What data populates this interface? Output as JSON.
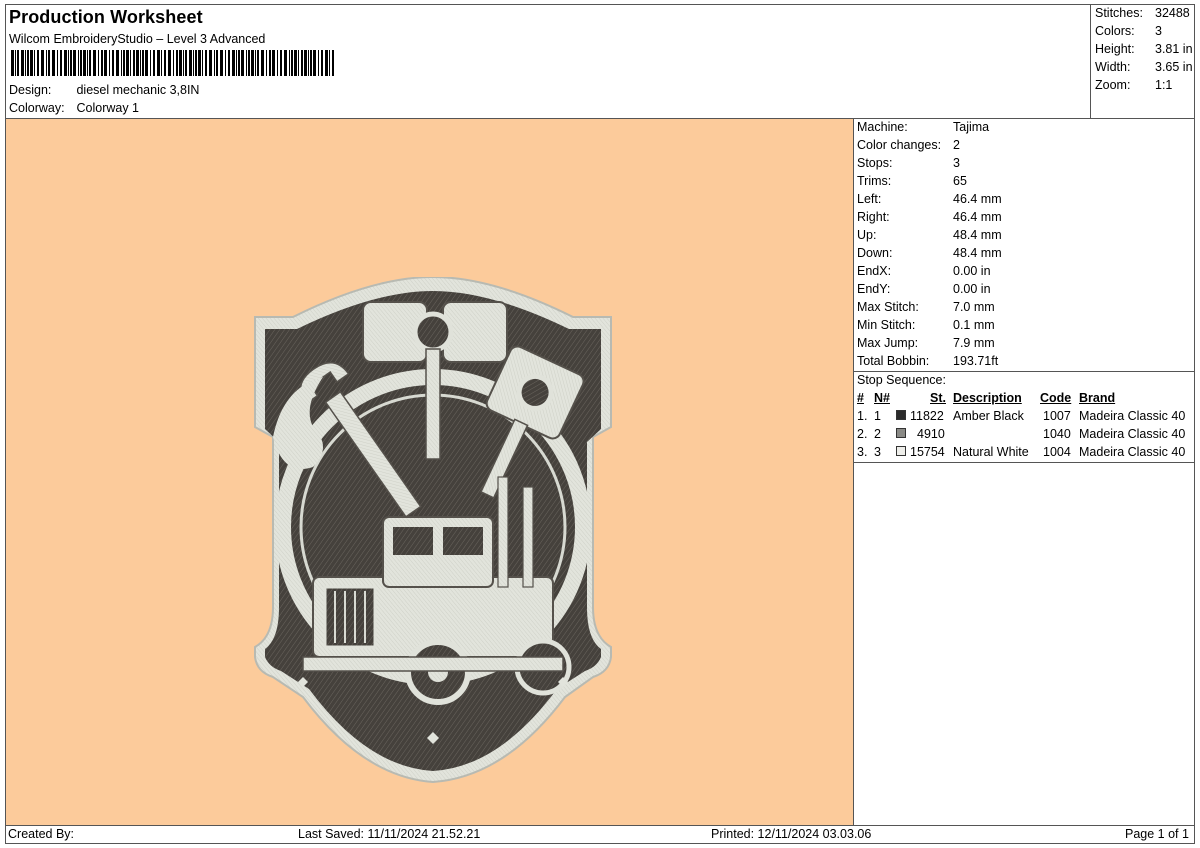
{
  "header": {
    "title": "Production Worksheet",
    "app": "Wilcom EmbroideryStudio – Level 3 Advanced",
    "design_label": "Design:",
    "design_value": "diesel mechanic 3,8IN",
    "colorway_label": "Colorway:",
    "colorway_value": "Colorway 1"
  },
  "summary": [
    {
      "label": "Stitches:",
      "value": "32488"
    },
    {
      "label": "Colors:",
      "value": "3"
    },
    {
      "label": "Height:",
      "value": "3.81 in"
    },
    {
      "label": "Width:",
      "value": "3.65 in"
    },
    {
      "label": "Zoom:",
      "value": "1:1"
    }
  ],
  "machine_info": [
    {
      "label": "Machine:",
      "value": "Tajima"
    },
    {
      "label": "Color changes:",
      "value": "2"
    },
    {
      "label": "Stops:",
      "value": "3"
    },
    {
      "label": "Trims:",
      "value": "65"
    },
    {
      "label": "Left:",
      "value": "46.4 mm"
    },
    {
      "label": "Right:",
      "value": "46.4 mm"
    },
    {
      "label": "Up:",
      "value": "48.4 mm"
    },
    {
      "label": "Down:",
      "value": "48.4 mm"
    },
    {
      "label": "EndX:",
      "value": "0.00 in"
    },
    {
      "label": "EndY:",
      "value": "0.00 in"
    },
    {
      "label": "Max Stitch:",
      "value": "7.0 mm"
    },
    {
      "label": "Min Stitch:",
      "value": "0.1 mm"
    },
    {
      "label": "Max Jump:",
      "value": "7.9 mm"
    },
    {
      "label": "Total Bobbin:",
      "value": "193.71ft"
    }
  ],
  "stop_sequence": {
    "title": "Stop Sequence:",
    "columns": {
      "num": "#",
      "n": "N#",
      "st": "St.",
      "description": "Description",
      "code": "Code",
      "brand": "Brand"
    },
    "rows": [
      {
        "num": "1.",
        "n": "1",
        "color": "#2b2b2b",
        "st": "11822",
        "description": "Amber Black",
        "code": "1007",
        "brand": "Madeira Classic 40"
      },
      {
        "num": "2.",
        "n": "2",
        "color": "#8a8a86",
        "st": "4910",
        "description": "",
        "code": "1040",
        "brand": "Madeira Classic 40"
      },
      {
        "num": "3.",
        "n": "3",
        "color": "#eeeeea",
        "st": "15754",
        "description": "Natural White",
        "code": "1004",
        "brand": "Madeira Classic 40"
      }
    ]
  },
  "footer": {
    "created_by": "Created By:",
    "last_saved": "Last Saved: 11/11/2024 21.52.21",
    "printed": "Printed: 12/11/2024 03.03.06",
    "page": "Page 1 of 1"
  },
  "colors": {
    "background": "#fccb9b",
    "thread_dark": "#3d3a36",
    "thread_light": "#e4e6df"
  }
}
